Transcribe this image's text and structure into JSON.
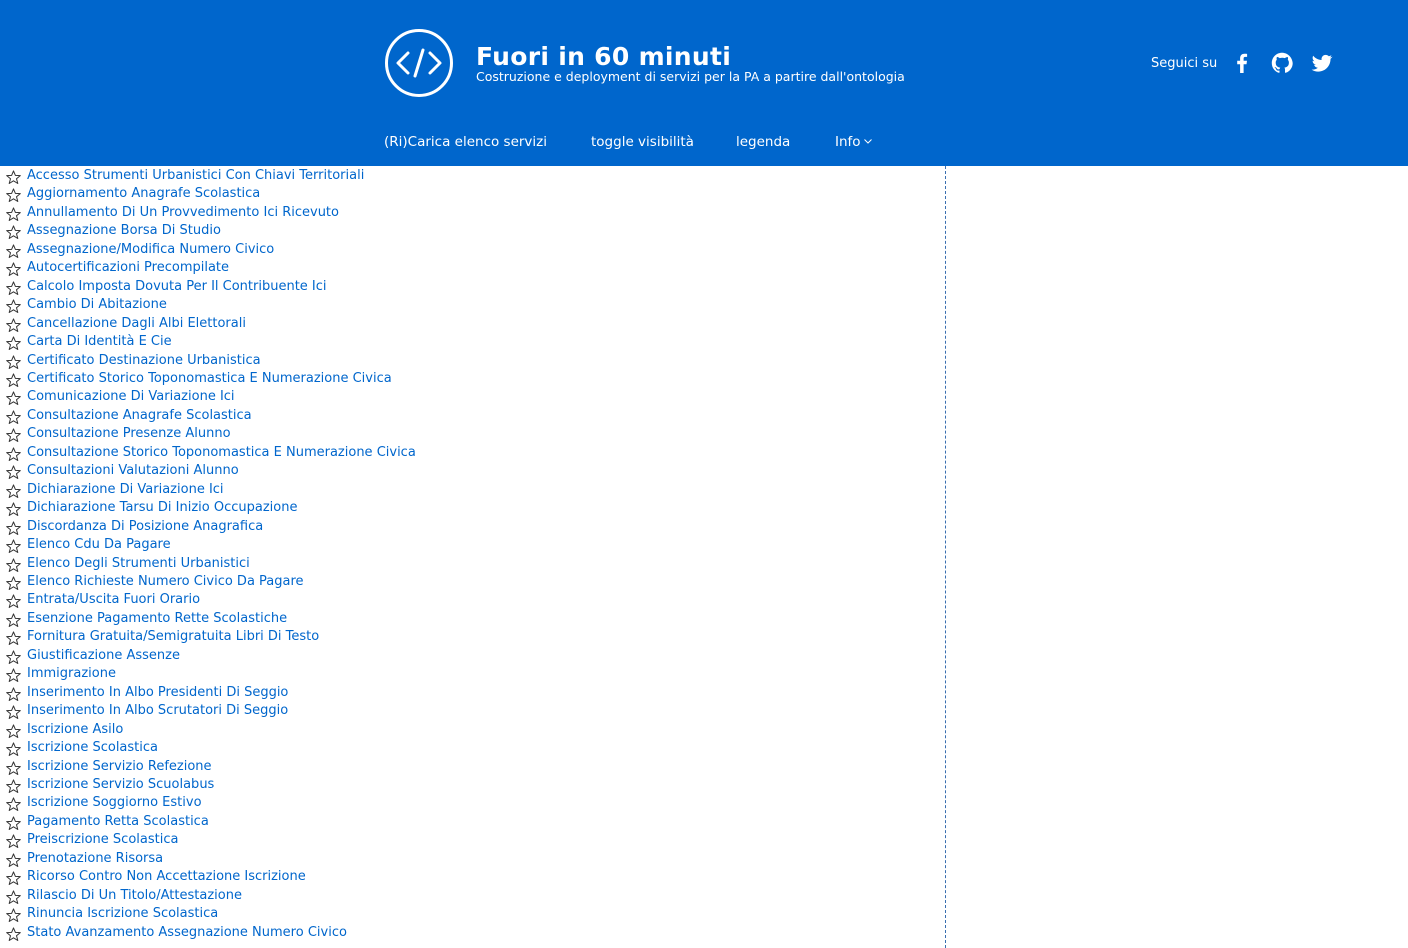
{
  "header": {
    "title": "Fuori in 60 minuti",
    "subtitle": "Costruzione e deployment di servizi per la PA a partire dall'ontologia",
    "follow_label": "Seguici su",
    "background": "#0066cc",
    "social": [
      "facebook-icon",
      "github-icon",
      "twitter-icon"
    ]
  },
  "nav": {
    "reload": "(Ri)Carica elenco servizi",
    "toggle": "toggle visibilità",
    "legend": "legenda",
    "info": "Info"
  },
  "services": [
    "Accesso Strumenti Urbanistici Con Chiavi Territoriali",
    "Aggiornamento Anagrafe Scolastica",
    "Annullamento Di Un Provvedimento Ici Ricevuto",
    "Assegnazione Borsa Di Studio",
    "Assegnazione/Modifica Numero Civico",
    "Autocertificazioni Precompilate",
    "Calcolo Imposta Dovuta Per Il Contribuente Ici",
    "Cambio Di Abitazione",
    "Cancellazione Dagli Albi Elettorali",
    "Carta Di Identità E Cie",
    "Certificato Destinazione Urbanistica",
    "Certificato Storico Toponomastica E Numerazione Civica",
    "Comunicazione Di Variazione Ici",
    "Consultazione Anagrafe Scolastica",
    "Consultazione Presenze Alunno",
    "Consultazione Storico Toponomastica E Numerazione Civica",
    "Consultazioni Valutazioni Alunno",
    "Dichiarazione Di Variazione Ici",
    "Dichiarazione Tarsu Di Inizio Occupazione",
    "Discordanza Di Posizione Anagrafica",
    "Elenco Cdu Da Pagare",
    "Elenco Degli Strumenti Urbanistici",
    "Elenco Richieste Numero Civico Da Pagare",
    "Entrata/Uscita Fuori Orario",
    "Esenzione Pagamento Rette Scolastiche",
    "Fornitura Gratuita/Semigratuita Libri Di Testo",
    "Giustificazione Assenze",
    "Immigrazione",
    "Inserimento In Albo Presidenti Di Seggio",
    "Inserimento In Albo Scrutatori Di Seggio",
    "Iscrizione Asilo",
    "Iscrizione Scolastica",
    "Iscrizione Servizio Refezione",
    "Iscrizione Servizio Scuolabus",
    "Iscrizione Soggiorno Estivo",
    "Pagamento Retta Scolastica",
    "Preiscrizione Scolastica",
    "Prenotazione Risorsa",
    "Ricorso Contro Non Accettazione Iscrizione",
    "Rilascio Di Un Titolo/Attestazione",
    "Rinuncia Iscrizione Scolastica",
    "Stato Avanzamento Assegnazione Numero Civico"
  ]
}
